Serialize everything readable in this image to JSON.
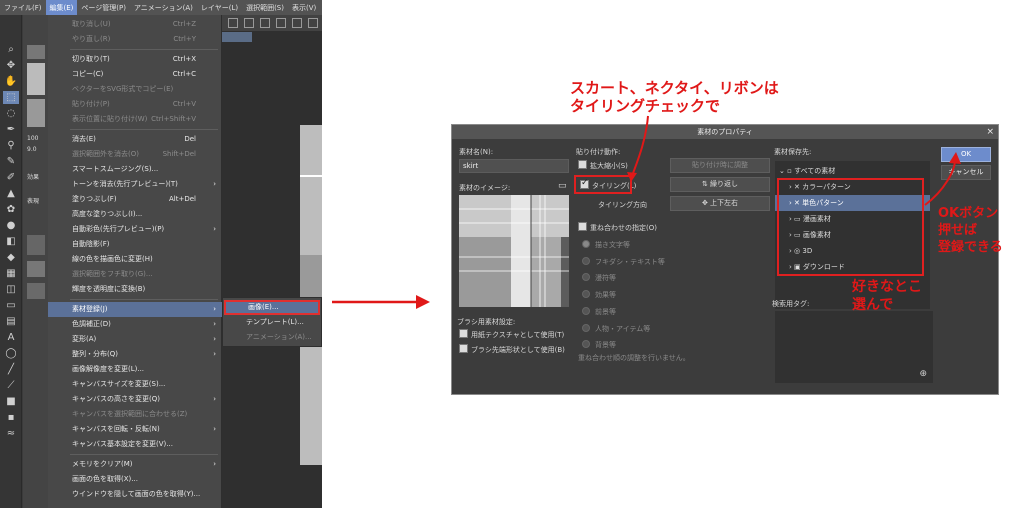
{
  "menubar": [
    "ファイル(F)",
    "編集(E)",
    "ページ管理(P)",
    "アニメーション(A)",
    "レイヤー(L)",
    "選択範囲(S)",
    "表示(V)"
  ],
  "edit_menu": [
    {
      "label": "取り消し(U)",
      "shortcut": "Ctrl+Z",
      "disabled": true
    },
    {
      "label": "やり直し(R)",
      "shortcut": "Ctrl+Y",
      "disabled": true
    },
    {
      "label": "切り取り(T)",
      "shortcut": "Ctrl+X"
    },
    {
      "label": "コピー(C)",
      "shortcut": "Ctrl+C"
    },
    {
      "label": "ベクターをSVG形式でコピー(E)",
      "disabled": true
    },
    {
      "label": "貼り付け(P)",
      "shortcut": "Ctrl+V",
      "disabled": true
    },
    {
      "label": "表示位置に貼り付け(W)",
      "shortcut": "Ctrl+Shift+V",
      "disabled": true
    },
    {
      "label": "消去(E)",
      "shortcut": "Del"
    },
    {
      "label": "選択範囲外を消去(O)",
      "shortcut": "Shift+Del",
      "disabled": true
    },
    {
      "label": "スマートスムージング(S)..."
    },
    {
      "label": "トーンを消去(先行プレビュー)(T)",
      "submenu": true
    },
    {
      "label": "塗りつぶし(F)",
      "shortcut": "Alt+Del"
    },
    {
      "label": "高度な塗りつぶし(I)..."
    },
    {
      "label": "自動彩色(先行プレビュー)(P)",
      "submenu": true
    },
    {
      "label": "自動陰影(F)"
    },
    {
      "label": "線の色を描画色に変更(H)"
    },
    {
      "label": "選択範囲をフチ取り(G)...",
      "disabled": true
    },
    {
      "label": "輝度を透明度に変換(B)"
    },
    {
      "label": "素材登録(J)",
      "submenu": true,
      "highlight": true
    },
    {
      "label": "色調補正(D)",
      "submenu": true
    },
    {
      "label": "変形(A)",
      "submenu": true
    },
    {
      "label": "整列・分布(Q)",
      "submenu": true
    },
    {
      "label": "画像解像度を変更(L)..."
    },
    {
      "label": "キャンバスサイズを変更(S)..."
    },
    {
      "label": "キャンバスの高さを変更(Q)",
      "submenu": true
    },
    {
      "label": "キャンバスを選択範囲に合わせる(Z)",
      "disabled": true
    },
    {
      "label": "キャンバスを回転・反転(N)",
      "submenu": true
    },
    {
      "label": "キャンバス基本設定を変更(V)..."
    },
    {
      "label": "メモリをクリア(M)",
      "submenu": true
    },
    {
      "label": "画面の色を取得(X)..."
    },
    {
      "label": "ウインドウを隠して画面の色を取得(Y)..."
    }
  ],
  "submenu": [
    {
      "label": "画像(E)...",
      "highlight": true
    },
    {
      "label": "テンプレート(L)..."
    },
    {
      "label": "アニメーション(A)...",
      "disabled": true
    }
  ],
  "left_panel": {
    "zoom": "100",
    "val": "9.0",
    "effect": "効果",
    "display": "表現"
  },
  "dialog": {
    "title": "素材のプロパティ",
    "close": "×",
    "name_label": "素材名(N):",
    "name_value": "skirt",
    "image_label": "素材のイメージ:",
    "brush_settings": "ブラシ用素材設定:",
    "paper_texture": "用紙テクスチャとして使用(T)",
    "brush_tip": "ブラシ先端形状として使用(B)",
    "paste_label": "貼り付け動作:",
    "scale": "拡大縮小(S)",
    "tiling": "タイリング(L)",
    "tiling_dir": "タイリング方向",
    "paste_adjust": "貼り付け時に調整",
    "repeat": "繰り返し",
    "direction": "上下左右",
    "overlap": "重ね合わせの指定(O)",
    "radio_items": [
      "描き文字等",
      "フキダシ・テキスト等",
      "漫符等",
      "効果等",
      "前景等",
      "人物・アイテム等",
      "背景等"
    ],
    "no_overlap": "重ね合わせ順の調整を行いません。",
    "save_to_label": "素材保存先:",
    "tree": [
      "すべての素材",
      "カラーパターン",
      "単色パターン",
      "漫画素材",
      "画像素材",
      "3D",
      "ダウンロード"
    ],
    "tag_label": "検索用タグ:",
    "ok": "OK",
    "cancel": "キャンセル"
  },
  "annotations": {
    "top_line1": "スカート、ネクタイ、リボンは",
    "top_line2": "タイリングチェックで",
    "ok_line1": "OKボタン",
    "ok_line2": "押せば",
    "ok_line3": "登録できる",
    "choose_line1": "好きなとこ",
    "choose_line2": "選んで"
  },
  "colors": {
    "accent": "#6d8ccc",
    "annotation": "#e01818",
    "highlight": "#5b7199"
  }
}
